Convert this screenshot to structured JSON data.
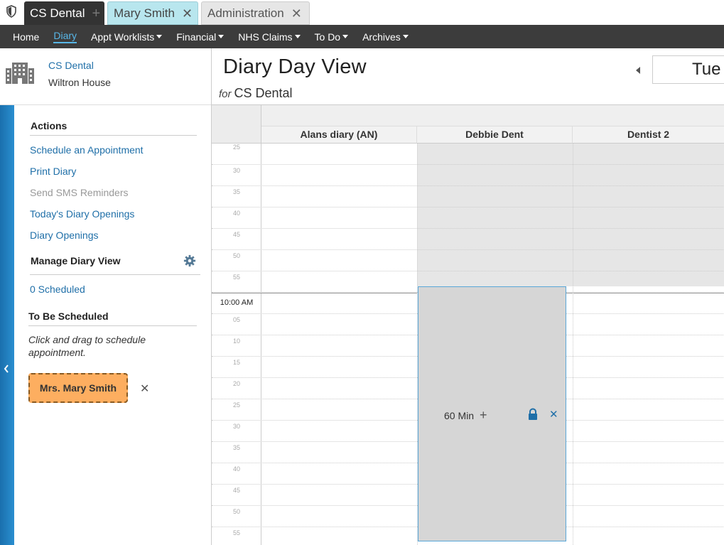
{
  "tabs": [
    {
      "label": "CS Dental",
      "icon": "plus-icon"
    },
    {
      "label": "Mary Smith",
      "icon": "close-icon"
    },
    {
      "label": "Administration",
      "icon": "close-icon"
    }
  ],
  "nav": {
    "items": [
      "Home",
      "Diary",
      "Appt Worklists",
      "Financial",
      "NHS Claims",
      "To Do",
      "Archives"
    ],
    "active": "Diary"
  },
  "practice": {
    "name": "CS Dental",
    "address": "Wiltron House"
  },
  "page": {
    "title": "Diary Day View",
    "for_label": "for",
    "for_value": "CS Dental",
    "date": "Tue"
  },
  "side": {
    "actions_heading": "Actions",
    "actions": [
      "Schedule an Appointment",
      "Print Diary",
      "Send SMS Reminders",
      "Today's Diary Openings",
      "Diary Openings"
    ],
    "manage_heading": "Manage Diary View",
    "scheduled_link": "0 Scheduled",
    "tbs_heading": "To Be Scheduled",
    "hint": "Click and drag to schedule appointment.",
    "patient_chip": "Mrs. Mary Smith"
  },
  "diary": {
    "columns": [
      "Alans diary (AN)",
      "Debbie Dent",
      "Dentist 2"
    ],
    "time_labels": [
      "25",
      "30",
      "35",
      "40",
      "45",
      "50",
      "55",
      "10:00 AM",
      "05",
      "10",
      "15",
      "20",
      "25",
      "30",
      "35",
      "40",
      "45",
      "50",
      "55"
    ],
    "block": {
      "duration": "60 Min"
    }
  },
  "colors": {
    "accent": "#1f6fa8",
    "chip": "#fdae60",
    "nav_bg": "#3c3c3c"
  }
}
